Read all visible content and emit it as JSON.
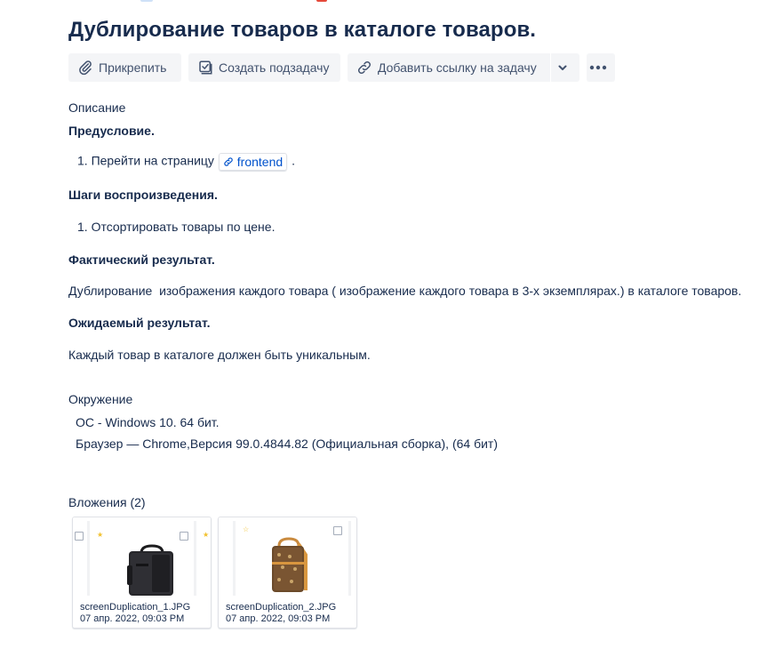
{
  "issue": {
    "title": "Дублирование товаров в каталоге товаров."
  },
  "toolbar": {
    "attach_label": "Прикрепить",
    "subtask_label": "Создать подзадачу",
    "link_label": "Добавить ссылку на задачу"
  },
  "description": {
    "label": "Описание",
    "precondition_heading": "Предусловие.",
    "precondition_item_number": "1.",
    "precondition_item_text": "Перейти на страницу",
    "precondition_link": "frontend",
    "precondition_item_end": ".",
    "steps_heading": "Шаги воспроизведения.",
    "steps_item_number": "1.",
    "steps_item_text": "Отсортировать товары по цене.",
    "actual_heading": "Фактический результат.",
    "actual_text": "Дублирование  изображения каждого товара ( изображение каждого товара в 3-х экземплярах.) в каталоге товаров.",
    "expected_heading": "Ожидаемый результат.",
    "expected_text": "Каждый товар в каталоге должен быть уникальным."
  },
  "environment": {
    "label": "Окружение",
    "os": "ОС - Windows 10. 64 бит.",
    "browser": "Браузер — Chrome,Версия 99.0.4844.82 (Официальная сборка), (64 бит)"
  },
  "attachments": {
    "label": "Вложения (2)",
    "items": [
      {
        "filename": "screenDuplication_1.JPG",
        "date": "07 апр. 2022, 09:03 PM"
      },
      {
        "filename": "screenDuplication_2.JPG",
        "date": "07 апр. 2022, 09:03 PM"
      }
    ]
  },
  "icons": {
    "attach": "paperclip-icon",
    "subtask": "checkbox-subtask-icon",
    "link": "chain-link-icon",
    "dropdown": "chevron-down-icon",
    "more": "more-dots-icon"
  },
  "colors": {
    "text": "#172b4d",
    "button_bg": "#f4f5f7",
    "link": "#0052cc"
  }
}
